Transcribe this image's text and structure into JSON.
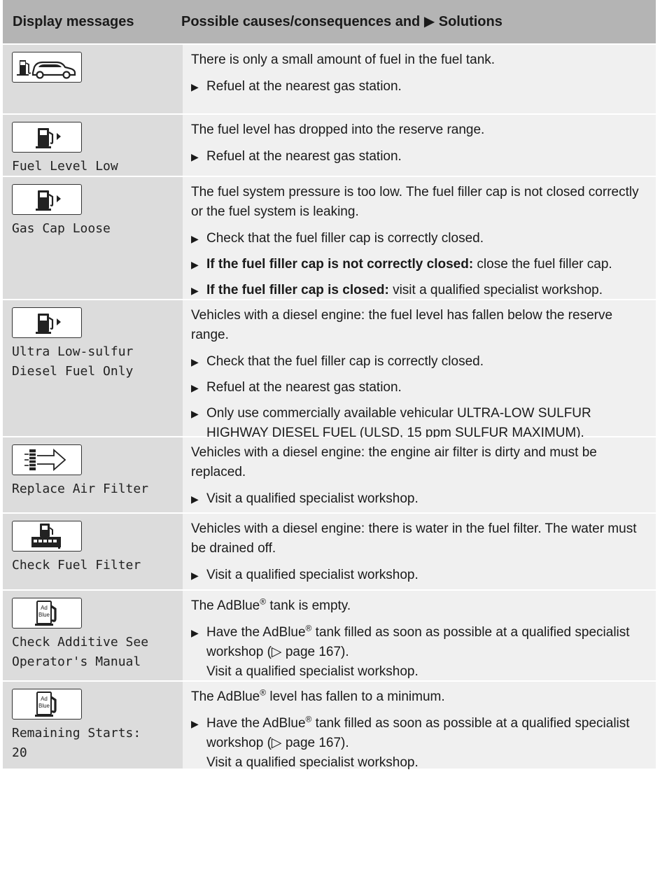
{
  "header": {
    "col1": "Display messages",
    "col2": "Possible causes/consequences and ▶ Solutions"
  },
  "rows": [
    {
      "icon": "car-fuel-icon",
      "message": "",
      "cause": "There is only a small amount of fuel in the fuel tank.",
      "steps": [
        {
          "bold": "",
          "text": "Refuel at the nearest gas station.",
          "extra": ""
        }
      ]
    },
    {
      "icon": "fuel-pump-icon",
      "message": "Fuel Level Low",
      "cause": "The fuel level has dropped into the reserve range.",
      "steps": [
        {
          "bold": "",
          "text": "Refuel at the nearest gas station.",
          "extra": ""
        }
      ]
    },
    {
      "icon": "fuel-pump-icon",
      "message": "Gas Cap Loose",
      "cause": "The fuel system pressure is too low. The fuel filler cap is not closed correctly or the fuel system is leaking.",
      "steps": [
        {
          "bold": "",
          "text": "Check that the fuel filler cap is correctly closed.",
          "extra": ""
        },
        {
          "bold": "If the fuel filler cap is not correctly closed:",
          "text": " close the fuel filler cap.",
          "extra": ""
        },
        {
          "bold": "If the fuel filler cap is closed:",
          "text": " visit a qualified specialist workshop.",
          "extra": ""
        }
      ]
    },
    {
      "icon": "fuel-pump-icon",
      "message": "Ultra Low-sulfur\nDiesel Fuel Only",
      "cause": "Vehicles with a diesel engine: the fuel level has fallen below the reserve range.",
      "steps": [
        {
          "bold": "",
          "text": "Check that the fuel filler cap is correctly closed.",
          "extra": ""
        },
        {
          "bold": "",
          "text": "Refuel at the nearest gas station.",
          "extra": ""
        },
        {
          "bold": "",
          "text": "Only use commercially available vehicular ULTRA-LOW SULFUR HIGHWAY DIESEL FUEL (ULSD, 15 ppm SULFUR MAXIMUM).",
          "extra": ""
        }
      ]
    },
    {
      "icon": "air-filter-icon",
      "message": "Replace Air Filter",
      "cause": "Vehicles with a diesel engine: the engine air filter is dirty and must be replaced.",
      "steps": [
        {
          "bold": "",
          "text": "Visit a qualified specialist workshop.",
          "extra": ""
        }
      ]
    },
    {
      "icon": "fuel-filter-icon",
      "message": "Check Fuel Filter",
      "cause": "Vehicles with a diesel engine: there is water in the fuel filter. The water must be drained off.",
      "steps": [
        {
          "bold": "",
          "text": "Visit a qualified specialist workshop.",
          "extra": ""
        }
      ]
    },
    {
      "icon": "adblue-icon",
      "message": "Check Additive See\nOperator's Manual",
      "cause": "The AdBlue® tank is empty.",
      "steps": [
        {
          "bold": "",
          "text": "Have the AdBlue® tank filled as soon as possible at a qualified specialist workshop (▷ page 167).",
          "extra": "Visit a qualified specialist workshop."
        }
      ]
    },
    {
      "icon": "adblue-icon",
      "message": "Remaining Starts:\n20",
      "cause": "The AdBlue® level has fallen to a minimum.",
      "steps": [
        {
          "bold": "",
          "text": "Have the AdBlue® tank filled as soon as possible at a qualified specialist workshop (▷ page 167).",
          "extra": "Visit a qualified specialist workshop."
        }
      ]
    }
  ],
  "icon_text": {
    "adblue": "Ad\nBlue"
  }
}
